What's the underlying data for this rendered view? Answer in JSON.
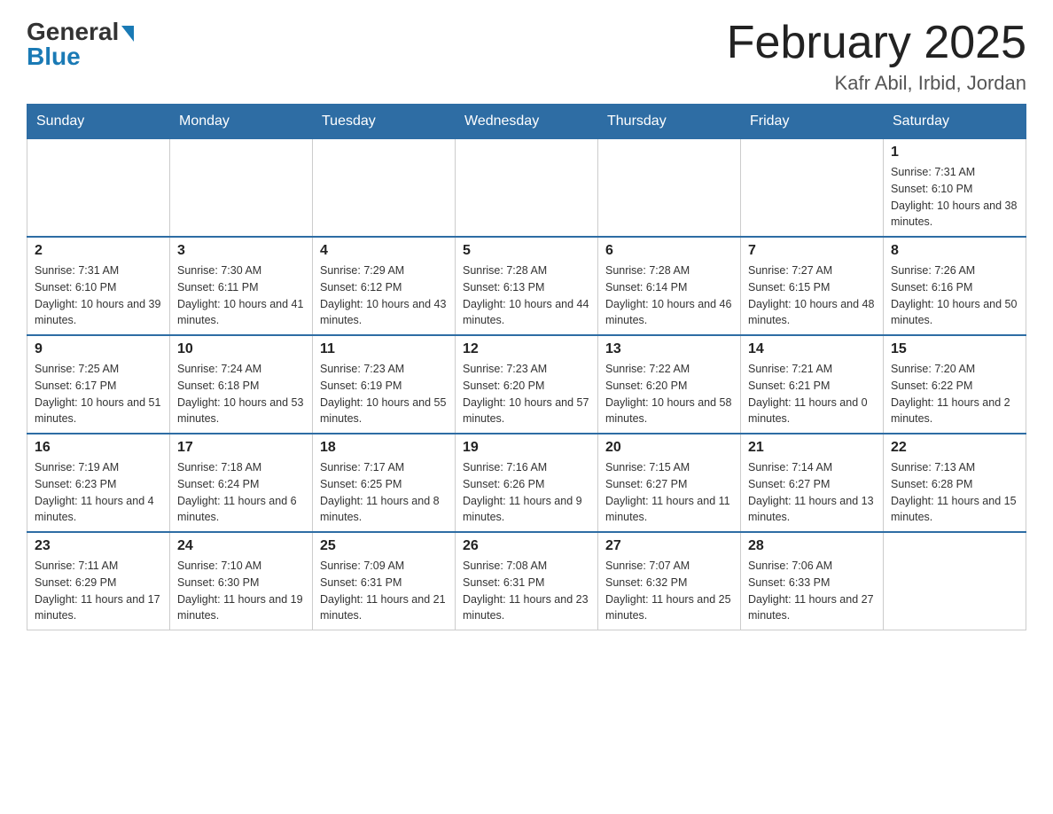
{
  "header": {
    "logo_general": "General",
    "logo_blue": "Blue",
    "month_title": "February 2025",
    "location": "Kafr Abil, Irbid, Jordan"
  },
  "days_of_week": [
    "Sunday",
    "Monday",
    "Tuesday",
    "Wednesday",
    "Thursday",
    "Friday",
    "Saturday"
  ],
  "weeks": [
    [
      {
        "day": "",
        "sunrise": "",
        "sunset": "",
        "daylight": ""
      },
      {
        "day": "",
        "sunrise": "",
        "sunset": "",
        "daylight": ""
      },
      {
        "day": "",
        "sunrise": "",
        "sunset": "",
        "daylight": ""
      },
      {
        "day": "",
        "sunrise": "",
        "sunset": "",
        "daylight": ""
      },
      {
        "day": "",
        "sunrise": "",
        "sunset": "",
        "daylight": ""
      },
      {
        "day": "",
        "sunrise": "",
        "sunset": "",
        "daylight": ""
      },
      {
        "day": "1",
        "sunrise": "Sunrise: 7:31 AM",
        "sunset": "Sunset: 6:10 PM",
        "daylight": "Daylight: 10 hours and 38 minutes."
      }
    ],
    [
      {
        "day": "2",
        "sunrise": "Sunrise: 7:31 AM",
        "sunset": "Sunset: 6:10 PM",
        "daylight": "Daylight: 10 hours and 39 minutes."
      },
      {
        "day": "3",
        "sunrise": "Sunrise: 7:30 AM",
        "sunset": "Sunset: 6:11 PM",
        "daylight": "Daylight: 10 hours and 41 minutes."
      },
      {
        "day": "4",
        "sunrise": "Sunrise: 7:29 AM",
        "sunset": "Sunset: 6:12 PM",
        "daylight": "Daylight: 10 hours and 43 minutes."
      },
      {
        "day": "5",
        "sunrise": "Sunrise: 7:28 AM",
        "sunset": "Sunset: 6:13 PM",
        "daylight": "Daylight: 10 hours and 44 minutes."
      },
      {
        "day": "6",
        "sunrise": "Sunrise: 7:28 AM",
        "sunset": "Sunset: 6:14 PM",
        "daylight": "Daylight: 10 hours and 46 minutes."
      },
      {
        "day": "7",
        "sunrise": "Sunrise: 7:27 AM",
        "sunset": "Sunset: 6:15 PM",
        "daylight": "Daylight: 10 hours and 48 minutes."
      },
      {
        "day": "8",
        "sunrise": "Sunrise: 7:26 AM",
        "sunset": "Sunset: 6:16 PM",
        "daylight": "Daylight: 10 hours and 50 minutes."
      }
    ],
    [
      {
        "day": "9",
        "sunrise": "Sunrise: 7:25 AM",
        "sunset": "Sunset: 6:17 PM",
        "daylight": "Daylight: 10 hours and 51 minutes."
      },
      {
        "day": "10",
        "sunrise": "Sunrise: 7:24 AM",
        "sunset": "Sunset: 6:18 PM",
        "daylight": "Daylight: 10 hours and 53 minutes."
      },
      {
        "day": "11",
        "sunrise": "Sunrise: 7:23 AM",
        "sunset": "Sunset: 6:19 PM",
        "daylight": "Daylight: 10 hours and 55 minutes."
      },
      {
        "day": "12",
        "sunrise": "Sunrise: 7:23 AM",
        "sunset": "Sunset: 6:20 PM",
        "daylight": "Daylight: 10 hours and 57 minutes."
      },
      {
        "day": "13",
        "sunrise": "Sunrise: 7:22 AM",
        "sunset": "Sunset: 6:20 PM",
        "daylight": "Daylight: 10 hours and 58 minutes."
      },
      {
        "day": "14",
        "sunrise": "Sunrise: 7:21 AM",
        "sunset": "Sunset: 6:21 PM",
        "daylight": "Daylight: 11 hours and 0 minutes."
      },
      {
        "day": "15",
        "sunrise": "Sunrise: 7:20 AM",
        "sunset": "Sunset: 6:22 PM",
        "daylight": "Daylight: 11 hours and 2 minutes."
      }
    ],
    [
      {
        "day": "16",
        "sunrise": "Sunrise: 7:19 AM",
        "sunset": "Sunset: 6:23 PM",
        "daylight": "Daylight: 11 hours and 4 minutes."
      },
      {
        "day": "17",
        "sunrise": "Sunrise: 7:18 AM",
        "sunset": "Sunset: 6:24 PM",
        "daylight": "Daylight: 11 hours and 6 minutes."
      },
      {
        "day": "18",
        "sunrise": "Sunrise: 7:17 AM",
        "sunset": "Sunset: 6:25 PM",
        "daylight": "Daylight: 11 hours and 8 minutes."
      },
      {
        "day": "19",
        "sunrise": "Sunrise: 7:16 AM",
        "sunset": "Sunset: 6:26 PM",
        "daylight": "Daylight: 11 hours and 9 minutes."
      },
      {
        "day": "20",
        "sunrise": "Sunrise: 7:15 AM",
        "sunset": "Sunset: 6:27 PM",
        "daylight": "Daylight: 11 hours and 11 minutes."
      },
      {
        "day": "21",
        "sunrise": "Sunrise: 7:14 AM",
        "sunset": "Sunset: 6:27 PM",
        "daylight": "Daylight: 11 hours and 13 minutes."
      },
      {
        "day": "22",
        "sunrise": "Sunrise: 7:13 AM",
        "sunset": "Sunset: 6:28 PM",
        "daylight": "Daylight: 11 hours and 15 minutes."
      }
    ],
    [
      {
        "day": "23",
        "sunrise": "Sunrise: 7:11 AM",
        "sunset": "Sunset: 6:29 PM",
        "daylight": "Daylight: 11 hours and 17 minutes."
      },
      {
        "day": "24",
        "sunrise": "Sunrise: 7:10 AM",
        "sunset": "Sunset: 6:30 PM",
        "daylight": "Daylight: 11 hours and 19 minutes."
      },
      {
        "day": "25",
        "sunrise": "Sunrise: 7:09 AM",
        "sunset": "Sunset: 6:31 PM",
        "daylight": "Daylight: 11 hours and 21 minutes."
      },
      {
        "day": "26",
        "sunrise": "Sunrise: 7:08 AM",
        "sunset": "Sunset: 6:31 PM",
        "daylight": "Daylight: 11 hours and 23 minutes."
      },
      {
        "day": "27",
        "sunrise": "Sunrise: 7:07 AM",
        "sunset": "Sunset: 6:32 PM",
        "daylight": "Daylight: 11 hours and 25 minutes."
      },
      {
        "day": "28",
        "sunrise": "Sunrise: 7:06 AM",
        "sunset": "Sunset: 6:33 PM",
        "daylight": "Daylight: 11 hours and 27 minutes."
      },
      {
        "day": "",
        "sunrise": "",
        "sunset": "",
        "daylight": ""
      }
    ]
  ]
}
